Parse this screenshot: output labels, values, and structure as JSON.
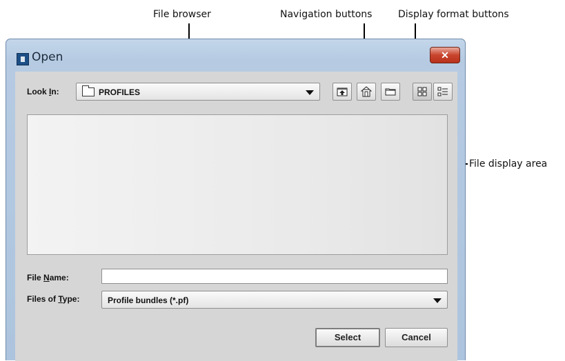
{
  "callouts": {
    "file_browser": "File browser",
    "navigation_buttons": "Navigation buttons",
    "display_format_buttons": "Display format buttons",
    "file_display_area": "File display area"
  },
  "window": {
    "title": "Open",
    "close_glyph": "✕"
  },
  "look_in": {
    "label_prefix": "Look ",
    "label_mnemonic": "I",
    "label_suffix": "n:",
    "selected_folder": "PROFILES",
    "folder_icon": "folder-icon"
  },
  "toolbar": {
    "icons": [
      "up-one-level-icon",
      "home-icon",
      "new-folder-icon",
      "list-view-icon",
      "details-view-icon"
    ]
  },
  "file_name": {
    "label_prefix": "File ",
    "label_mnemonic": "N",
    "label_suffix": "ame:",
    "value": ""
  },
  "files_of_type": {
    "label_prefix": "Files of ",
    "label_mnemonic": "T",
    "label_suffix": "ype:",
    "selected": "Profile bundles (*.pf)"
  },
  "buttons": {
    "select": "Select",
    "cancel": "Cancel"
  }
}
